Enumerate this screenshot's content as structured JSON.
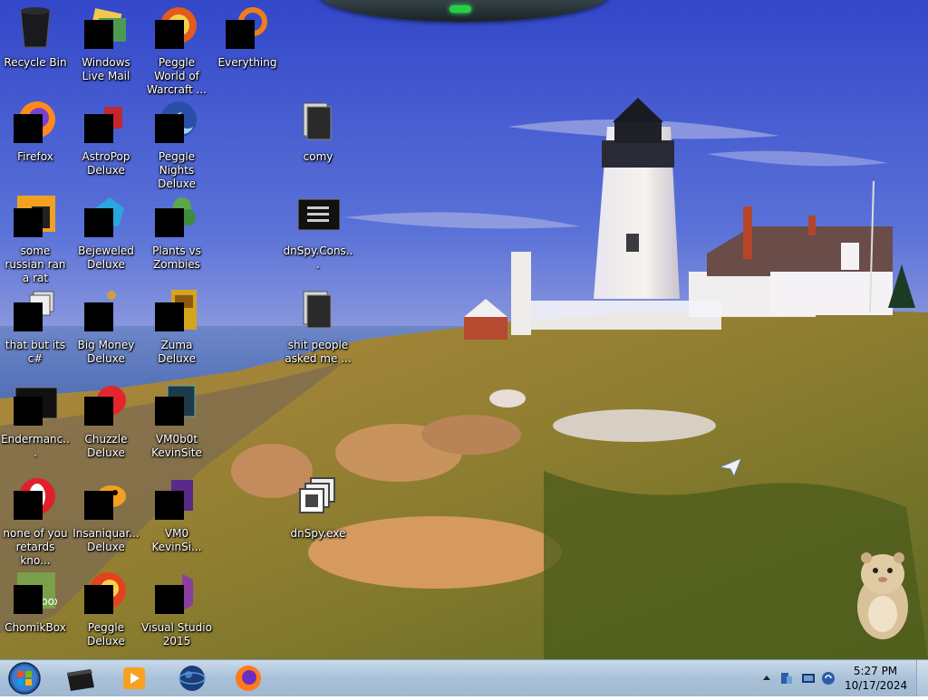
{
  "desktop": {
    "wallpaper_subject": "lighthouse",
    "icons": [
      {
        "id": "recycle-bin",
        "label": "Recycle Bin",
        "icon": "recycle-bin-icon"
      },
      {
        "id": "windows-live-mail",
        "label": "Windows Live Mail",
        "icon": "mail-icon"
      },
      {
        "id": "peggle-world-of-warcraft",
        "label": "Peggle World of Warcraft ...",
        "icon": "peggle-icon"
      },
      {
        "id": "everything",
        "label": "Everything",
        "icon": "search-icon"
      },
      {
        "id": "firefox",
        "label": "Firefox",
        "icon": "firefox-icon"
      },
      {
        "id": "astropop-deluxe",
        "label": "AstroPop Deluxe",
        "icon": "game-icon"
      },
      {
        "id": "peggle-nights-deluxe",
        "label": "Peggle Nights Deluxe",
        "icon": "peggle-icon"
      },
      {
        "id": "comy",
        "label": "comy",
        "icon": "folder-icon"
      },
      {
        "id": "some-russian-ran-a-rat",
        "label": "some russian ran a rat",
        "icon": "application-icon"
      },
      {
        "id": "bejeweled-deluxe",
        "label": "Bejeweled Deluxe",
        "icon": "gem-icon"
      },
      {
        "id": "plants-vs-zombies",
        "label": "Plants vs Zombies",
        "icon": "plant-icon"
      },
      {
        "id": "dnspy-console",
        "label": "dnSpy.Cons...",
        "icon": "console-icon"
      },
      {
        "id": "that-but-its-c",
        "label": "that but its c#",
        "icon": "application-icon"
      },
      {
        "id": "big-money-deluxe",
        "label": "Big Money Deluxe",
        "icon": "money-bag-icon"
      },
      {
        "id": "zuma-deluxe",
        "label": "Zuma Deluxe",
        "icon": "zuma-icon"
      },
      {
        "id": "shit-people-asked-me",
        "label": "shit people asked me ...",
        "icon": "folder-icon"
      },
      {
        "id": "endermanch",
        "label": "Endermanc...",
        "icon": "console-icon"
      },
      {
        "id": "chuzzle-deluxe",
        "label": "Chuzzle Deluxe",
        "icon": "chuzzle-icon"
      },
      {
        "id": "vm0b0t-kevinsite",
        "label": "VM0b0t KevinSite",
        "icon": "application-icon"
      },
      {
        "id": "none-of-you-retards",
        "label": "none of you retards kno...",
        "icon": "opera-icon"
      },
      {
        "id": "insaniquarium-deluxe",
        "label": "Insaniquar... Deluxe",
        "icon": "fish-icon"
      },
      {
        "id": "vm0-kevinsite",
        "label": "VM0 KevinSi...",
        "icon": "application-icon"
      },
      {
        "id": "dnspy-exe",
        "label": "dnSpy.exe",
        "icon": "dnspy-icon"
      },
      {
        "id": "chomikbox",
        "label": "ChomikBox",
        "icon": "chomikbox-icon"
      },
      {
        "id": "peggle-deluxe",
        "label": "Peggle Deluxe",
        "icon": "peggle-icon"
      },
      {
        "id": "visual-studio-2015",
        "label": "Visual Studio 2015",
        "icon": "visual-studio-icon"
      }
    ]
  },
  "taskbar": {
    "pinned": [
      {
        "id": "start",
        "icon": "windows-start-icon"
      },
      {
        "id": "explorer",
        "icon": "explorer-icon"
      },
      {
        "id": "media-player",
        "icon": "media-player-icon"
      },
      {
        "id": "internet-explorer",
        "icon": "globe-icon"
      },
      {
        "id": "firefox",
        "icon": "firefox-icon"
      }
    ],
    "tray": {
      "icons": [
        "show-hidden-icons-chevron",
        "network-icon",
        "display-icon",
        "volume-icon"
      ],
      "time": "5:27 PM",
      "date": "10/17/2024"
    }
  },
  "colors": {
    "taskbar": "#b4c8dc",
    "sky_top": "#3b4fd0",
    "grass": "#8c7a2a",
    "ocean": "#2a5aa8"
  }
}
